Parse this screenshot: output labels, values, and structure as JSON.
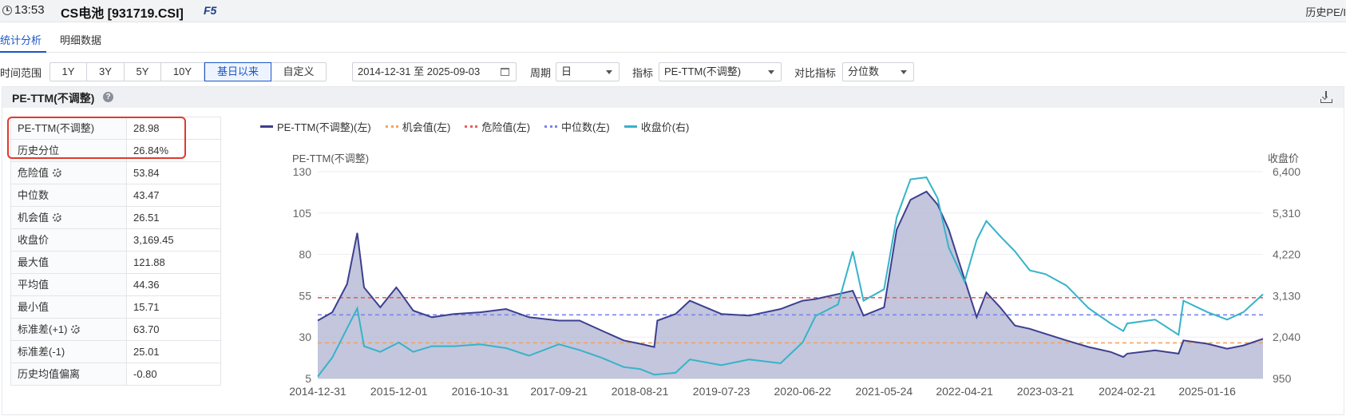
{
  "header": {
    "time": "13:53",
    "security": "CS电池 [931719.CSI]",
    "hotkey": "F5",
    "right_label": "历史PE/I"
  },
  "tabs": [
    {
      "label": "统计分析",
      "active": true
    },
    {
      "label": "明细数据",
      "active": false
    }
  ],
  "filter": {
    "range_label": "时间范围",
    "ranges": [
      {
        "label": "1Y",
        "active": false
      },
      {
        "label": "3Y",
        "active": false
      },
      {
        "label": "5Y",
        "active": false
      },
      {
        "label": "10Y",
        "active": false
      },
      {
        "label": "基日以来",
        "active": true
      },
      {
        "label": "自定义",
        "active": false
      }
    ],
    "date_range": "2014-12-31 至 2025-09-03",
    "period_label": "周期",
    "period_value": "日",
    "indicator_label": "指标",
    "indicator_value": "PE-TTM(不调整)",
    "compare_label": "对比指标",
    "compare_value": "分位数"
  },
  "panel": {
    "title": "PE-TTM(不调整)"
  },
  "stats": [
    {
      "label": "PE-TTM(不调整)",
      "value": "28.98",
      "gear": false
    },
    {
      "label": "历史分位",
      "value": "26.84%",
      "gear": false
    },
    {
      "label": "危险值",
      "value": "53.84",
      "gear": true
    },
    {
      "label": "中位数",
      "value": "43.47",
      "gear": false
    },
    {
      "label": "机会值",
      "value": "26.51",
      "gear": true
    },
    {
      "label": "收盘价",
      "value": "3,169.45",
      "gear": false
    },
    {
      "label": "最大值",
      "value": "121.88",
      "gear": false
    },
    {
      "label": "平均值",
      "value": "44.36",
      "gear": false
    },
    {
      "label": "最小值",
      "value": "15.71",
      "gear": false
    },
    {
      "label": "标准差(+1)",
      "value": "63.70",
      "gear": true
    },
    {
      "label": "标准差(-1)",
      "value": "25.01",
      "gear": false
    },
    {
      "label": "历史均值偏离",
      "value": "-0.80",
      "gear": false
    }
  ],
  "colors": {
    "pe": "#3c3f8f",
    "pe_fill": "#b9bcd6",
    "opportunity": "#f5a25d",
    "danger": "#ee5b5b",
    "median": "#7a84ef",
    "close": "#36b3c9",
    "accent": "#1a56c8",
    "highlight": "#e03a2e"
  },
  "chart_data": {
    "type": "line",
    "left_axis_label": "PE-TTM(不调整)",
    "right_axis_label": "收盘价",
    "left_ticks": [
      "130",
      "105",
      "80",
      "55",
      "30",
      "5"
    ],
    "left_ylim": [
      5,
      130
    ],
    "right_ticks": [
      "6,400",
      "5,310",
      "4,220",
      "3,130",
      "2,040",
      "950"
    ],
    "right_ylim": [
      950,
      6400
    ],
    "x_ticks": [
      "2014-12-31",
      "2015-12-01",
      "2016-10-31",
      "2017-09-21",
      "2018-08-21",
      "2019-07-23",
      "2020-06-22",
      "2021-05-24",
      "2022-04-21",
      "2023-03-21",
      "2024-02-21",
      "2025-01-16"
    ],
    "reference_lines": [
      {
        "name": "机会值(左)",
        "value": 26.51,
        "color": "#f5a25d"
      },
      {
        "name": "危险值(左)",
        "value": 53.84,
        "color": "#ee5b5b"
      },
      {
        "name": "中位数(左)",
        "value": 43.47,
        "color": "#7a84ef"
      }
    ],
    "series": [
      {
        "name": "PE-TTM(不调整)(左)",
        "axis": "left",
        "points": [
          [
            "2014-12-31",
            40
          ],
          [
            "2015-03-01",
            45
          ],
          [
            "2015-05-01",
            62
          ],
          [
            "2015-06-12",
            93
          ],
          [
            "2015-07-10",
            60
          ],
          [
            "2015-09-15",
            48
          ],
          [
            "2015-11-20",
            60
          ],
          [
            "2015-12-01",
            58
          ],
          [
            "2016-01-29",
            46
          ],
          [
            "2016-04-15",
            42
          ],
          [
            "2016-07-15",
            44
          ],
          [
            "2016-10-31",
            45
          ],
          [
            "2017-02-15",
            47
          ],
          [
            "2017-05-20",
            42
          ],
          [
            "2017-09-21",
            40
          ],
          [
            "2017-12-15",
            40
          ],
          [
            "2018-03-15",
            34
          ],
          [
            "2018-06-15",
            28
          ],
          [
            "2018-08-21",
            26
          ],
          [
            "2018-10-19",
            24
          ],
          [
            "2018-11-01",
            40
          ],
          [
            "2019-01-15",
            44
          ],
          [
            "2019-03-15",
            52
          ],
          [
            "2019-07-23",
            44
          ],
          [
            "2019-11-15",
            43
          ],
          [
            "2020-03-23",
            47
          ],
          [
            "2020-06-22",
            52
          ],
          [
            "2020-08-15",
            53
          ],
          [
            "2020-11-15",
            56
          ],
          [
            "2021-01-15",
            58
          ],
          [
            "2021-02-28",
            43
          ],
          [
            "2021-05-24",
            48
          ],
          [
            "2021-07-15",
            95
          ],
          [
            "2021-09-10",
            113
          ],
          [
            "2021-11-15",
            118
          ],
          [
            "2021-12-31",
            110
          ],
          [
            "2022-02-15",
            95
          ],
          [
            "2022-04-21",
            65
          ],
          [
            "2022-06-10",
            42
          ],
          [
            "2022-07-20",
            57
          ],
          [
            "2022-09-15",
            48
          ],
          [
            "2022-11-15",
            37
          ],
          [
            "2023-01-15",
            35
          ],
          [
            "2023-03-21",
            32
          ],
          [
            "2023-06-15",
            28
          ],
          [
            "2023-09-15",
            24
          ],
          [
            "2023-12-15",
            21
          ],
          [
            "2024-02-05",
            18
          ],
          [
            "2024-02-21",
            20
          ],
          [
            "2024-06-15",
            22
          ],
          [
            "2024-09-20",
            20
          ],
          [
            "2024-10-10",
            28
          ],
          [
            "2025-01-16",
            26
          ],
          [
            "2025-04-08",
            23
          ],
          [
            "2025-06-15",
            25
          ],
          [
            "2025-09-03",
            28.98
          ]
        ]
      },
      {
        "name": "收盘价(右)",
        "axis": "right",
        "points": [
          [
            "2014-12-31",
            1000
          ],
          [
            "2015-03-01",
            1500
          ],
          [
            "2015-06-12",
            2800
          ],
          [
            "2015-07-10",
            1800
          ],
          [
            "2015-09-15",
            1650
          ],
          [
            "2015-12-01",
            1900
          ],
          [
            "2016-01-29",
            1650
          ],
          [
            "2016-04-15",
            1800
          ],
          [
            "2016-07-15",
            1800
          ],
          [
            "2016-10-31",
            1850
          ],
          [
            "2017-02-15",
            1750
          ],
          [
            "2017-05-20",
            1550
          ],
          [
            "2017-09-21",
            1850
          ],
          [
            "2017-12-15",
            1700
          ],
          [
            "2018-03-15",
            1500
          ],
          [
            "2018-06-15",
            1250
          ],
          [
            "2018-08-21",
            1200
          ],
          [
            "2018-10-19",
            1050
          ],
          [
            "2019-01-15",
            1100
          ],
          [
            "2019-03-15",
            1450
          ],
          [
            "2019-07-23",
            1300
          ],
          [
            "2019-11-15",
            1450
          ],
          [
            "2020-03-23",
            1350
          ],
          [
            "2020-06-22",
            1900
          ],
          [
            "2020-08-15",
            2600
          ],
          [
            "2020-11-15",
            2900
          ],
          [
            "2021-01-15",
            4300
          ],
          [
            "2021-02-28",
            3000
          ],
          [
            "2021-05-24",
            3300
          ],
          [
            "2021-07-15",
            5200
          ],
          [
            "2021-09-10",
            6200
          ],
          [
            "2021-11-15",
            6250
          ],
          [
            "2021-12-31",
            5700
          ],
          [
            "2022-02-15",
            4400
          ],
          [
            "2022-04-21",
            3500
          ],
          [
            "2022-06-10",
            4600
          ],
          [
            "2022-07-20",
            5100
          ],
          [
            "2022-09-15",
            4700
          ],
          [
            "2022-11-15",
            4300
          ],
          [
            "2023-01-15",
            3800
          ],
          [
            "2023-03-21",
            3700
          ],
          [
            "2023-06-15",
            3400
          ],
          [
            "2023-09-15",
            2800
          ],
          [
            "2023-12-15",
            2400
          ],
          [
            "2024-02-05",
            2200
          ],
          [
            "2024-02-21",
            2400
          ],
          [
            "2024-06-15",
            2500
          ],
          [
            "2024-09-20",
            2100
          ],
          [
            "2024-10-10",
            3000
          ],
          [
            "2025-01-16",
            2700
          ],
          [
            "2025-04-08",
            2500
          ],
          [
            "2025-06-15",
            2700
          ],
          [
            "2025-09-03",
            3169.45
          ]
        ]
      }
    ]
  }
}
